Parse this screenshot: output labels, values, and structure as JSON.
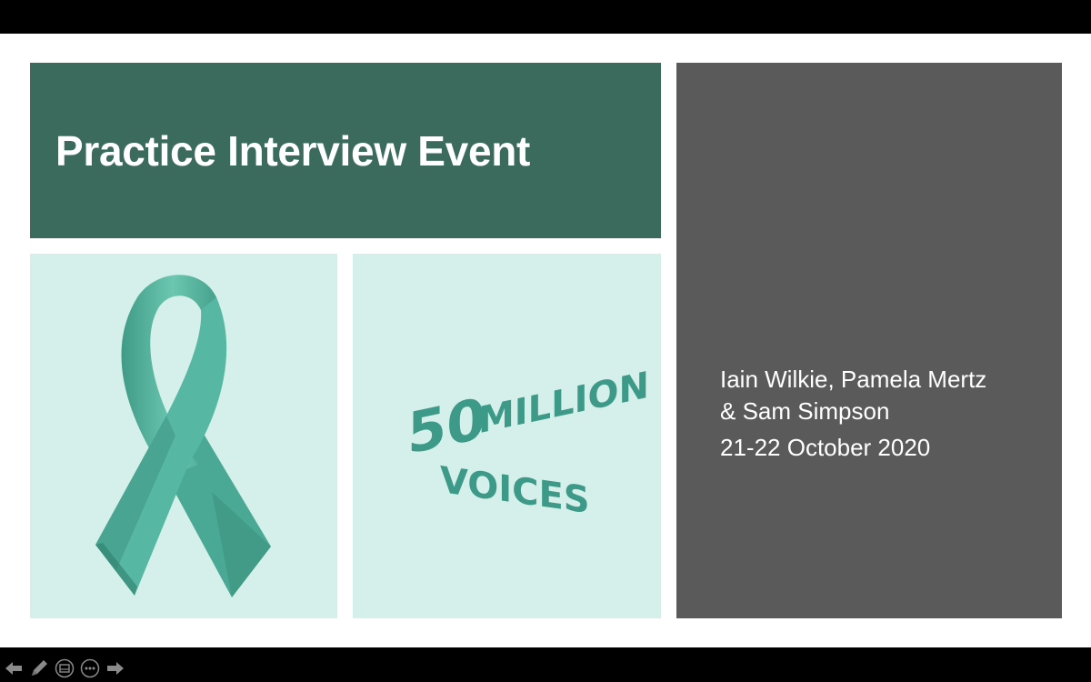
{
  "colors": {
    "title_bg": "#3b6b5c",
    "side_bg": "#5a5a5a",
    "tile_bg": "#d5f0ea",
    "ribbon": "#4aa994",
    "logo": "#3e9a88",
    "screen_border": "#000000"
  },
  "slide": {
    "title": "Practice Interview Event",
    "presenters_line1": "Iain Wilkie, Pamela Mertz",
    "presenters_line2": "& Sam Simpson",
    "date": "21-22 October 2020"
  },
  "logo": {
    "number": "50",
    "word1": "MILLION",
    "word2": "VOICES"
  },
  "images": {
    "ribbon": "awareness-ribbon",
    "logo": "50-million-voices-logo"
  },
  "toolbar": {
    "icons": [
      "arrow-left-icon",
      "pen-icon",
      "slides-grid-icon",
      "more-options-icon",
      "arrow-right-icon"
    ]
  }
}
